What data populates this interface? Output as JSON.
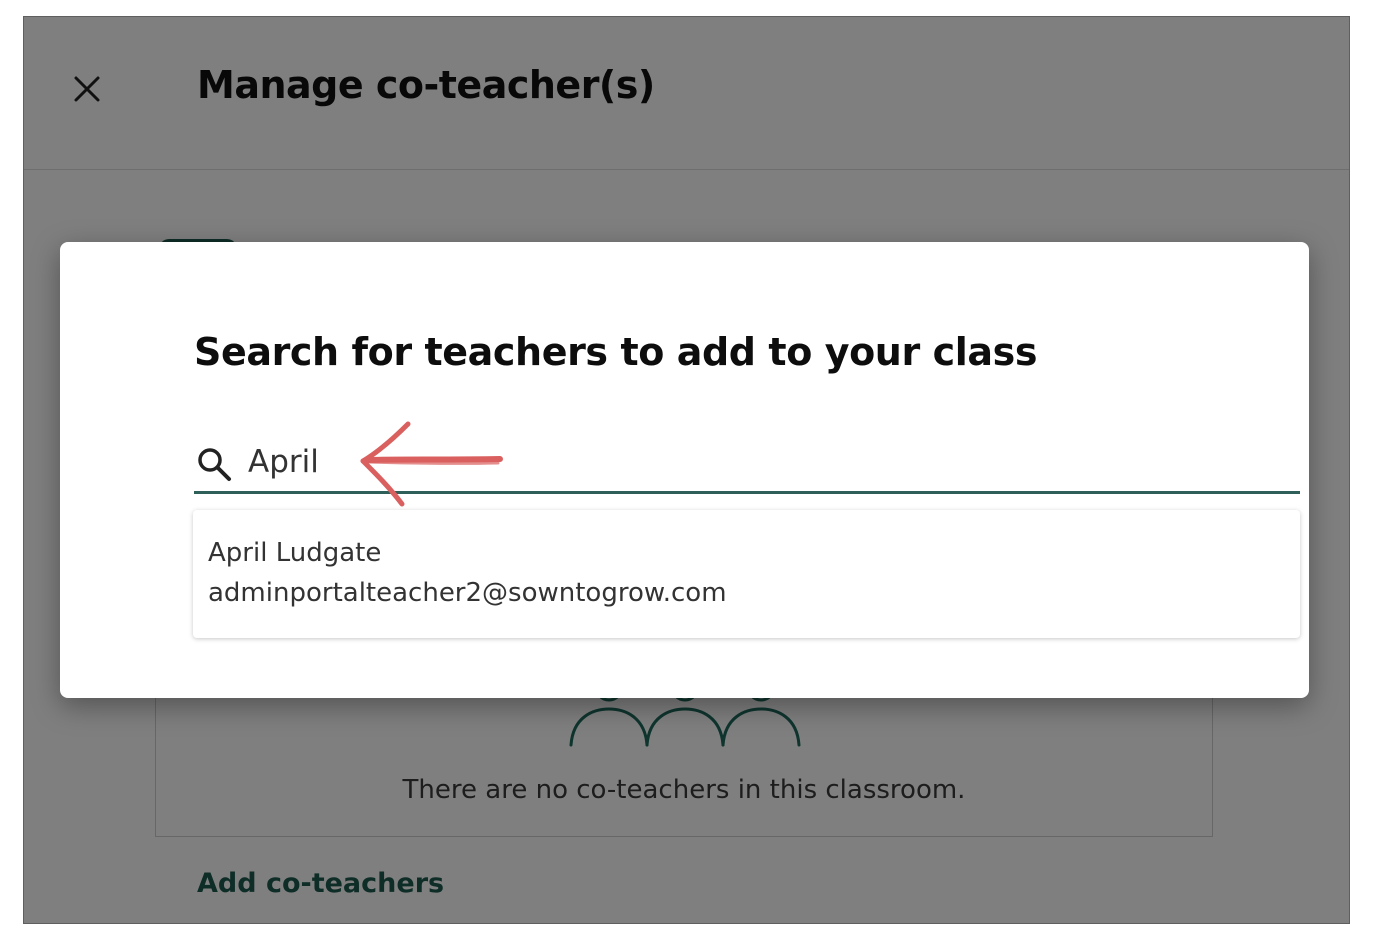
{
  "page": {
    "title": "Manage co-teacher(s)",
    "empty_state_text": "There are no co-teachers in this classroom.",
    "add_link_label": "Add co-teachers",
    "close_icon": "close-icon",
    "empty_icon": "people-group-icon"
  },
  "modal": {
    "title": "Search for teachers to add to your class",
    "search": {
      "value": "April",
      "icon": "search-icon"
    },
    "results": [
      {
        "name": "April Ludgate",
        "email": "adminportalteacher2@sowntogrow.com"
      }
    ],
    "annotation": "red-arrow-icon"
  },
  "colors": {
    "accent": "#1f5a4e",
    "search_underline": "#2e5f58",
    "overlay": "rgba(0,0,0,0.5)",
    "annotation": "#d9605e"
  }
}
